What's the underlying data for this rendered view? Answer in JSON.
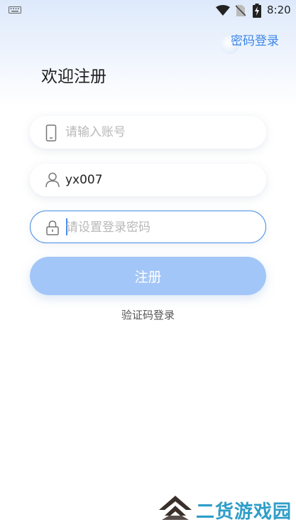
{
  "status_bar": {
    "time": "8:20",
    "icons": [
      "keyboard-icon",
      "wifi-icon",
      "no-sim-icon",
      "battery-charging-icon"
    ]
  },
  "header": {
    "password_login_link": "密码登录",
    "title": "欢迎注册"
  },
  "form": {
    "phone": {
      "icon": "phone-icon",
      "value": "",
      "placeholder": "请输入账号"
    },
    "username": {
      "icon": "user-icon",
      "value": "yx007",
      "placeholder": ""
    },
    "password": {
      "icon": "lock-icon",
      "value": "",
      "placeholder": "请设置登录密码"
    },
    "register_button": "注册",
    "sms_login_link": "验证码登录"
  },
  "watermark": {
    "text": "二货游戏园",
    "icon": "watermark-logo-icon"
  },
  "colors": {
    "accent": "#3d86e8",
    "button_disabled": "#a3c6f8",
    "watermark": "#2f9dc8"
  }
}
